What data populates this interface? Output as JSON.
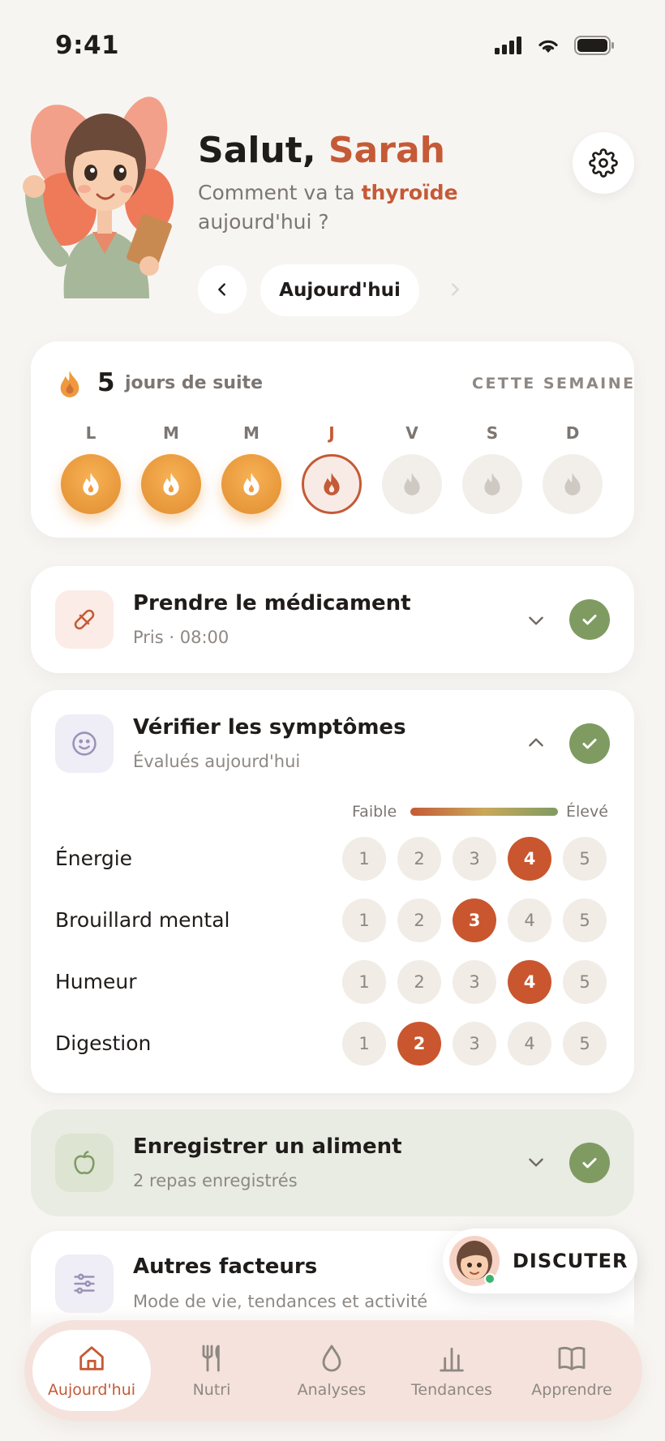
{
  "status_bar": {
    "time": "9:41"
  },
  "header": {
    "greeting_prefix": "Salut, ",
    "user_name": "Sarah",
    "subtitle_before": "Comment va ta ",
    "subtitle_accent": "thyroïde",
    "subtitle_after": " aujourd'hui ?",
    "date_label": "Aujourd'hui"
  },
  "streak": {
    "count": "5",
    "label": "jours de suite",
    "period_label": "CETTE SEMAINE",
    "days": [
      {
        "letter": "L",
        "state": "done"
      },
      {
        "letter": "M",
        "state": "done"
      },
      {
        "letter": "M",
        "state": "done"
      },
      {
        "letter": "J",
        "state": "today"
      },
      {
        "letter": "V",
        "state": "future"
      },
      {
        "letter": "S",
        "state": "future"
      },
      {
        "letter": "D",
        "state": "future"
      }
    ]
  },
  "tasks": {
    "medication": {
      "title": "Prendre le médicament",
      "subtitle": "Pris · 08:00",
      "completed": true
    },
    "symptoms": {
      "title": "Vérifier les symptômes",
      "subtitle": "Évalués aujourd'hui",
      "completed": true,
      "scale_low": "Faible",
      "scale_high": "Élevé",
      "scale_options": [
        "1",
        "2",
        "3",
        "4",
        "5"
      ],
      "items": [
        {
          "label": "Énergie",
          "value": 4
        },
        {
          "label": "Brouillard mental",
          "value": 3
        },
        {
          "label": "Humeur",
          "value": 4
        },
        {
          "label": "Digestion",
          "value": 2
        }
      ]
    },
    "food": {
      "title": "Enregistrer un aliment",
      "subtitle": "2 repas enregistrés",
      "completed": true
    },
    "other": {
      "title": "Autres facteurs",
      "subtitle": "Mode de vie, tendances et activité"
    }
  },
  "chat": {
    "label": "DISCUTER"
  },
  "tabbar": {
    "items": [
      {
        "label": "Aujourd'hui",
        "icon": "home-icon",
        "active": true
      },
      {
        "label": "Nutri",
        "icon": "utensils-icon",
        "active": false
      },
      {
        "label": "Analyses",
        "icon": "drop-icon",
        "active": false
      },
      {
        "label": "Tendances",
        "icon": "bar-chart-icon",
        "active": false
      },
      {
        "label": "Apprendre",
        "icon": "book-icon",
        "active": false
      }
    ]
  },
  "colors": {
    "accent": "#c55a36",
    "success": "#7f9b62",
    "background": "#f7f5f2",
    "streak": "#f0a040",
    "tabbar": "#f5e2dc"
  }
}
